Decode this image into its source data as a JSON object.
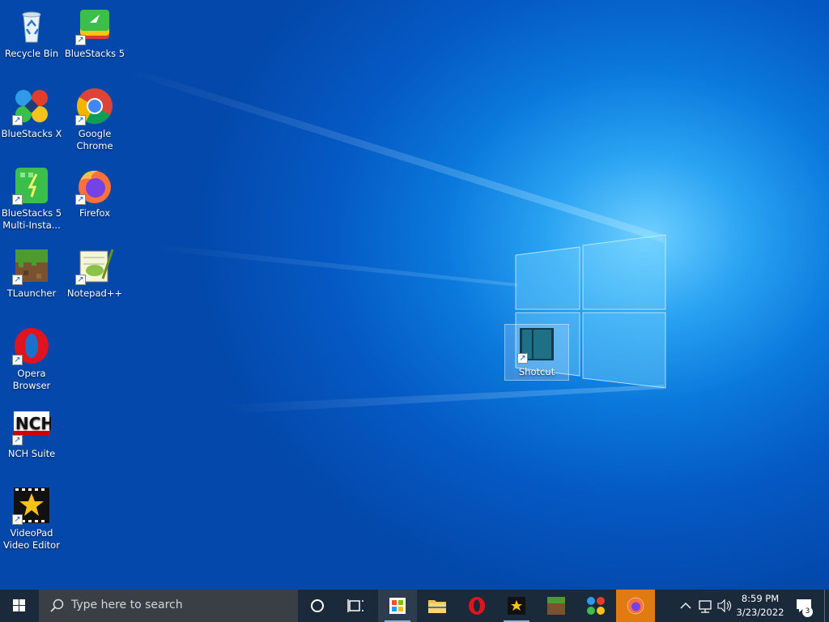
{
  "desktop": {
    "icons": [
      {
        "id": "recycle-bin",
        "label": "Recycle Bin"
      },
      {
        "id": "bluestacks5",
        "label": "BlueStacks 5"
      },
      {
        "id": "bluestacksx",
        "label": "BlueStacks X"
      },
      {
        "id": "chrome",
        "label": "Google Chrome"
      },
      {
        "id": "bs5-multi",
        "label": "BlueStacks 5 Multi-Insta..."
      },
      {
        "id": "firefox",
        "label": "Firefox"
      },
      {
        "id": "tlauncher",
        "label": "TLauncher"
      },
      {
        "id": "notepadpp",
        "label": "Notepad++"
      },
      {
        "id": "opera",
        "label": "Opera Browser"
      },
      {
        "id": "nch",
        "label": "NCH Suite"
      },
      {
        "id": "videopad",
        "label": "VideoPad Video Editor"
      },
      {
        "id": "shotcut",
        "label": "Shotcut"
      }
    ]
  },
  "taskbar": {
    "search_placeholder": "Type here to search",
    "pinned": [
      "cortana",
      "task-view",
      "microsoft-store",
      "file-explorer",
      "opera",
      "videopad",
      "tlauncher",
      "bluestacks-x",
      "firefox"
    ],
    "time": "8:59 PM",
    "date": "3/23/2022",
    "notification_count": "3"
  },
  "colors": {
    "taskbar": "#1b2a3a",
    "accent": "#0a78dc",
    "firefox_highlight": "#e27a12"
  }
}
